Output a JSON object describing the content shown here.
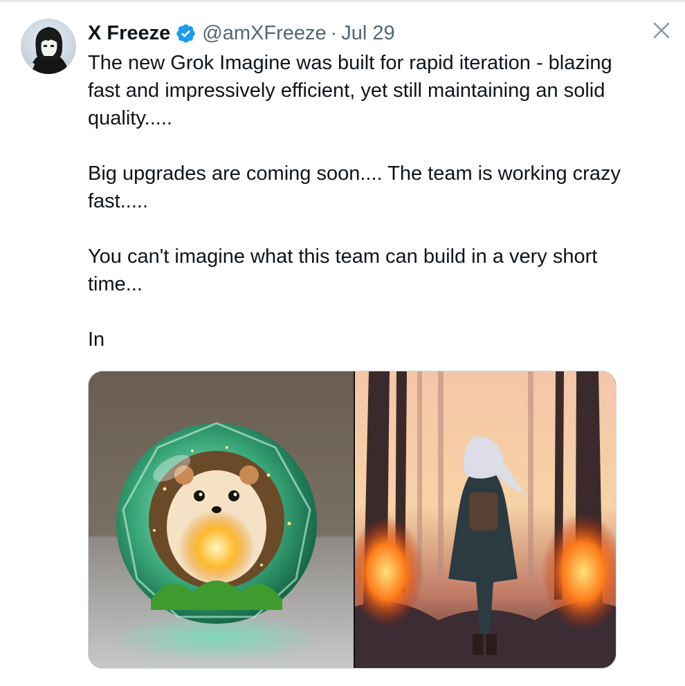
{
  "tweet": {
    "author_name": "X Freeze",
    "handle": "@amXFreeze",
    "separator": "·",
    "date": "Jul 29",
    "paragraphs": [
      "The new Grok Imagine was built for rapid iteration - blazing fast and impressively efficient, yet still maintaining an solid quality.....",
      "Big upgrades are coming soon.... The team is working crazy fast.....",
      "You can't imagine what this team can build in a very short time...",
      "In"
    ]
  },
  "icons": {
    "verified": "verified-badge-icon",
    "close": "close-icon"
  },
  "colors": {
    "text_primary": "#0f1419",
    "text_secondary": "#536471",
    "verified_blue": "#1d9bf0",
    "close_gray": "#8b98a5"
  }
}
